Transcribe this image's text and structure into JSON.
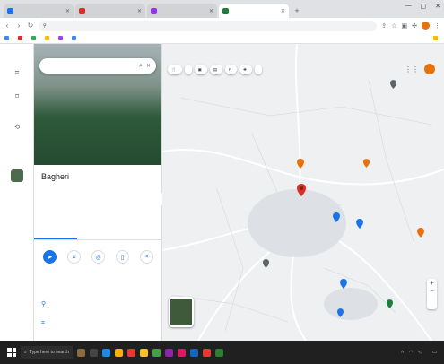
{
  "browser": {
    "tabs": [
      {
        "title": "",
        "color": "#1a73e8"
      },
      {
        "title": "",
        "color": "#d93025"
      },
      {
        "title": "",
        "color": "#9334e6"
      },
      {
        "title": "",
        "color": "#188038",
        "active": true
      }
    ],
    "new_tab": "+",
    "address": "",
    "bookmarks": [
      {
        "label": "",
        "color": "#4285f4"
      },
      {
        "label": "",
        "color": "#d93025"
      },
      {
        "label": "",
        "color": "#34a853"
      },
      {
        "label": "",
        "color": "#fbbc04"
      },
      {
        "label": "",
        "color": "#a142f4"
      },
      {
        "label": "",
        "color": "#4285f4"
      }
    ],
    "all_bookmarks": ""
  },
  "rail": {
    "menu_icon": "menu-icon",
    "saved": "",
    "recents": "",
    "place": ""
  },
  "place": {
    "search_value": "",
    "name": "Bagheri",
    "subtitle": "",
    "rating_text": "",
    "category": "",
    "tabs": [
      "",
      "",
      ""
    ],
    "actions": [
      "",
      "",
      "",
      "",
      ""
    ],
    "info_rows": [
      "",
      ""
    ]
  },
  "map": {
    "chips": [
      "",
      "",
      "",
      "",
      "",
      "",
      "",
      ""
    ],
    "pin_label": "",
    "labels": [
      "",
      "",
      "",
      "",
      "",
      ""
    ],
    "layers_label": "",
    "footer": ""
  },
  "taskbar": {
    "search_placeholder": "Type here to search",
    "weather": "",
    "time": "",
    "date": ""
  },
  "colors": {
    "accent": "#1a73e8",
    "pin_red": "#d93025",
    "pin_orange": "#e8710a",
    "profile": "#e8710a"
  }
}
